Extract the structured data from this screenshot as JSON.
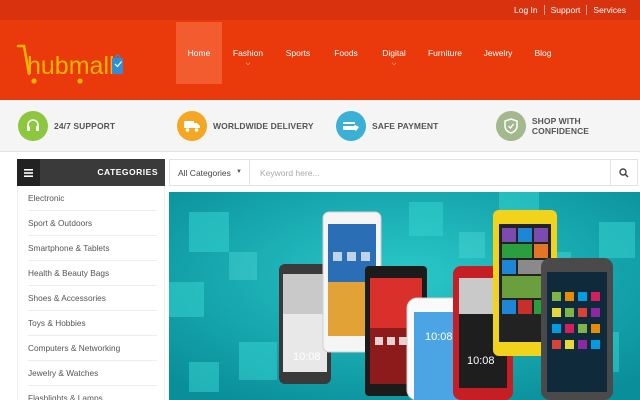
{
  "topbar": {
    "links": [
      "Log In",
      "Support",
      "Services"
    ]
  },
  "logo": {
    "text": "hubmall"
  },
  "nav": {
    "items": [
      {
        "label": "Home",
        "active": true,
        "dropdown": false
      },
      {
        "label": "Fashion",
        "active": false,
        "dropdown": true
      },
      {
        "label": "Sports",
        "active": false,
        "dropdown": false
      },
      {
        "label": "Foods",
        "active": false,
        "dropdown": false
      },
      {
        "label": "Digital",
        "active": false,
        "dropdown": true
      },
      {
        "label": "Furniture",
        "active": false,
        "dropdown": false
      },
      {
        "label": "Jewelry",
        "active": false,
        "dropdown": false
      },
      {
        "label": "Blog",
        "active": false,
        "dropdown": false
      }
    ]
  },
  "features": [
    {
      "label": "24/7 SUPPORT",
      "icon": "headset-icon",
      "color": "#8dc63f"
    },
    {
      "label": "WORLDWIDE DELIVERY",
      "icon": "truck-icon",
      "color": "#f5a623"
    },
    {
      "label": "SAFE PAYMENT",
      "icon": "payment-icon",
      "color": "#3ab0d6"
    },
    {
      "label": "SHOP WITH CONFIDENCE",
      "icon": "shield-icon",
      "color": "#a3b88c"
    }
  ],
  "categories": {
    "title": "CATEGORIES",
    "items": [
      "Electronic",
      "Sport & Outdoors",
      "Smartphone & Tablets",
      "Health & Beauty Bags",
      "Shoes & Accessories",
      "Toys & Hobbies",
      "Computers & Networking",
      "Jewelry & Watches",
      "Flashlights & Lamps"
    ]
  },
  "search": {
    "category_selected": "All Categories",
    "placeholder": "Keyword here..."
  },
  "banner": {
    "phone_time": "10:08"
  },
  "colors": {
    "topbar": "#d8330e",
    "header": "#ea3a0c",
    "nav_active": "#f35c2f",
    "banner_bg": "#12a9b3"
  }
}
